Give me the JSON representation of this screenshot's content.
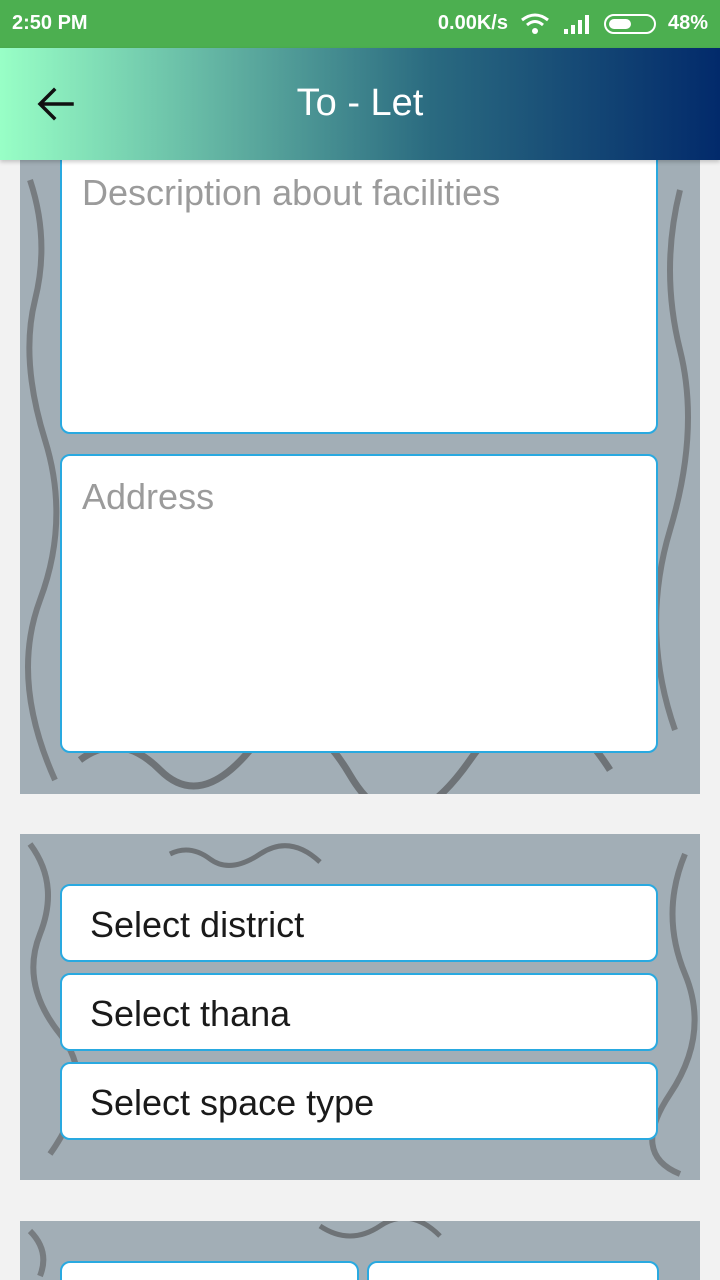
{
  "status_bar": {
    "time": "2:50 PM",
    "network_speed": "0.00K/s",
    "battery": "48%",
    "icons": [
      "wifi-icon",
      "signal-icon",
      "battery-icon"
    ]
  },
  "app_bar": {
    "title": "To - Let",
    "back_icon": "arrow-left-icon",
    "gradient": [
      "#98ffc6",
      "#022a6b"
    ]
  },
  "form": {
    "description_placeholder": "Description about facilities",
    "address_placeholder": "Address",
    "selects": {
      "district": "Select district",
      "thana": "Select thana",
      "space_type": "Select space type"
    }
  },
  "colors": {
    "status_bar": "#4caf50",
    "field_border": "#29a9e0",
    "panel": "#a2aeb6"
  }
}
